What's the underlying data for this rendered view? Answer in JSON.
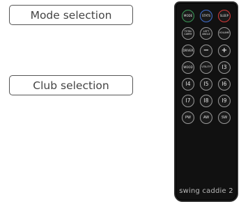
{
  "callouts": {
    "mode": "Mode selection",
    "club": "Club selection"
  },
  "remote": {
    "logo": "swing caddie 2",
    "buttons": {
      "mode": "MODE",
      "stats": "STATS",
      "sleep": "SLEEP",
      "total_carry": "TOTAL CARRY",
      "loft_angle": "LOFT ANGLE",
      "volume": "VOLUME",
      "driver": "DRIVER",
      "minus": "−",
      "plus": "+",
      "wood": "WOOD",
      "utility": "UTILITY",
      "i3": "I3",
      "i4": "I4",
      "i5": "I5",
      "i6": "I6",
      "i7": "I7",
      "i8": "I8",
      "i9": "I9",
      "pw": "PW",
      "aw": "AW",
      "sw": "SW"
    }
  },
  "colors": {
    "mode_ring": "#3a9a57",
    "stats_ring": "#3f6fd0",
    "sleep_ring": "#d83a3a",
    "button_ring": "#9a9a9a",
    "remote_body": "#111111"
  }
}
